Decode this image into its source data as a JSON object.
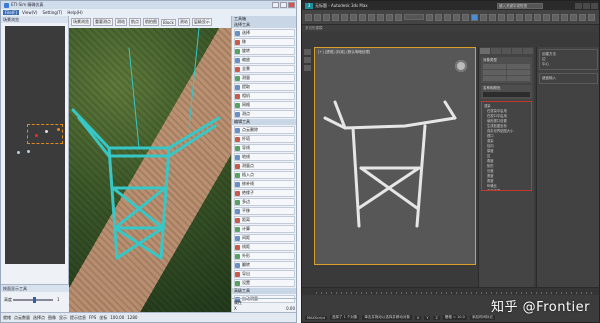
{
  "left_app": {
    "title": "ETI-Sim 精确仿真",
    "menu": [
      "File(F)",
      "View(V)",
      "Setting(T)",
      "Help(H)"
    ],
    "scene_pane_title": "场景浏览",
    "adjust_pane_title": "按面显示工具",
    "adjust_label": "高度",
    "adjust_value": "1",
    "view_tabs": [
      "场景浏览",
      "重要测点",
      "测站",
      "航点",
      "航拍图",
      "Block",
      "测站",
      "层级显示"
    ],
    "tools_header": "工具箱",
    "tool_section_1": "选择工具",
    "tools_1": [
      "选择",
      "移",
      "旋转",
      "缩放",
      "全景",
      "测量",
      "提取",
      "相机",
      "网格",
      "测点"
    ],
    "tool_section_2": "编辑工具",
    "tools_2": [
      "点云删除",
      "杆塔",
      "导线",
      "地线",
      "测量点",
      "插入点",
      "修补线",
      "绝缘子",
      "多边",
      "平移",
      "距离",
      "计算",
      "间距",
      "线距",
      "外形",
      "翻转",
      "导出",
      "设置"
    ],
    "tool_section_3": "高级工具",
    "tools_3": [
      "自动测量"
    ],
    "props_label": "属性",
    "props_row": [
      "X",
      "0.00"
    ],
    "status_items": [
      "就绪",
      "点云数量",
      "选择点",
      "图像",
      "显示",
      "提示信息",
      "FPS",
      "坐标",
      "100.00",
      "1280"
    ]
  },
  "right_app": {
    "logo": "3",
    "title": "无标题 - Autodesk 3ds Max",
    "search_placeholder": "键入关键字或短语",
    "toolbar2_label": "多边形建模",
    "viewport_label": "[+] [透视] [标准] [默认明暗处理]",
    "cmd_roll_1": "对象类型",
    "cmd_roll_2": "名称和颜色",
    "red_panel_lines": [
      "渲染",
      "在渲染中启用",
      "在视口中启用",
      "使用视口设置",
      "生成贴图坐标",
      "真实世界贴图大小",
      "视口",
      "渲染",
      "径向",
      "厚度",
      "边",
      "角度",
      "矩形",
      "长度",
      "宽度",
      "角度",
      "纵横比",
      "自动平滑",
      "阈值"
    ],
    "far_right_box_1": [
      "创建方法",
      "边",
      "中心"
    ],
    "far_right_box_2": "键盘输入",
    "status_items": [
      "MAXScript",
      "选择了 1 个对象",
      "单击并拖动以选择并移动对象",
      "X",
      "Y",
      "Z",
      "栅格 = 10.0",
      "添加时间标记"
    ]
  },
  "watermark": "知乎 @Frontier",
  "colors": {
    "tower_color": "#37c7c7",
    "model_color": "#e6e6e6",
    "selection_dash": "#e08a1e",
    "max_accent": "#4a8fd6",
    "highlight_red": "#c0392b"
  }
}
